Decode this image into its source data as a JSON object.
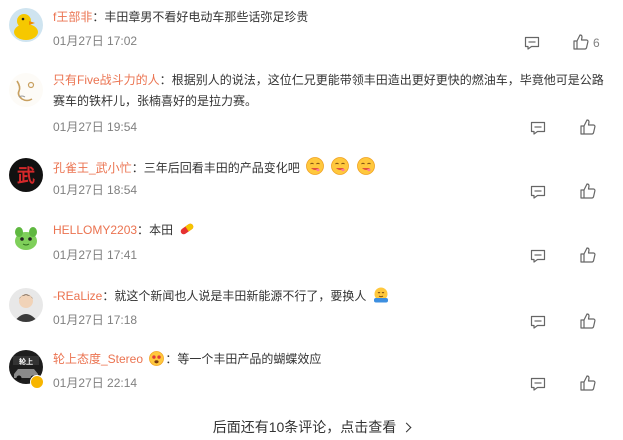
{
  "comments": [
    {
      "user": "f王部非",
      "sep": "：",
      "text": "丰田章男不看好电动车那些话弥足珍贵",
      "time": "01月27日 17:02",
      "likes": "6",
      "avatar": "duck-avatar"
    },
    {
      "user": "只有Five战斗力的人",
      "sep": "：",
      "text": "根据别人的说法，这位仁兄更能带领丰田造出更好更快的燃油车，毕竟他可是公路赛车的铁杆儿，张楠喜好的是拉力赛。",
      "time": "01月27日 19:54",
      "likes": "",
      "avatar": "sketch-avatar"
    },
    {
      "user": "孔雀王_武小忙",
      "sep": "：",
      "text": "三年后回看丰田的产品变化吧",
      "time": "01月27日 18:54",
      "likes": "",
      "avatar": "calligraphy-avatar",
      "emojis": [
        "yummy-emoji",
        "yummy-emoji",
        "yummy-emoji"
      ]
    },
    {
      "user": "HELLOMY2203",
      "sep": "：",
      "text": "本田",
      "time": "01月27日 17:41",
      "likes": "",
      "avatar": "green-creature-avatar",
      "emojis": [
        "pill-emoji"
      ]
    },
    {
      "user": "-REaLize",
      "sep": "：",
      "text": "就这个新闻也人说是丰田新能源不行了，要换人",
      "time": "01月27日 17:18",
      "likes": "",
      "avatar": "person-avatar",
      "emojis": [
        "hug-emoji"
      ]
    },
    {
      "user": "轮上态度_Stereo",
      "sep": "：",
      "text": "等一个丰田产品的蝴蝶效应",
      "time": "01月27日 22:14",
      "likes": "",
      "avatar": "car-avatar",
      "user_emoji": "excited-emoji"
    }
  ],
  "more_comments_label": "后面还有10条评论，点击查看"
}
